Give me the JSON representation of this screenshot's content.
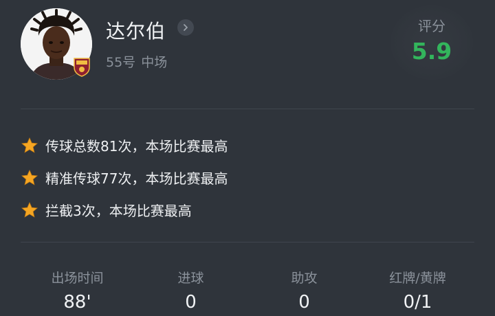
{
  "player": {
    "name": "达尔伯",
    "number": "55号",
    "position": "中场",
    "club_badge_text": "ROMA"
  },
  "rating": {
    "label": "评分",
    "value": "5.9",
    "color": "#33b55c"
  },
  "highlights": [
    {
      "icon": "star-icon",
      "text": "传球总数81次，本场比赛最高"
    },
    {
      "icon": "star-icon",
      "text": "精准传球77次，本场比赛最高"
    },
    {
      "icon": "star-icon",
      "text": "拦截3次，本场比赛最高"
    }
  ],
  "stats": [
    {
      "label": "出场时间",
      "value": "88'"
    },
    {
      "label": "进球",
      "value": "0"
    },
    {
      "label": "助攻",
      "value": "0"
    },
    {
      "label": "红牌/黄牌",
      "value": "0/1"
    }
  ],
  "colors": {
    "background": "#2f343b",
    "accent_green": "#33b55c",
    "star": "#f5a623",
    "muted_text": "#8b929b"
  }
}
